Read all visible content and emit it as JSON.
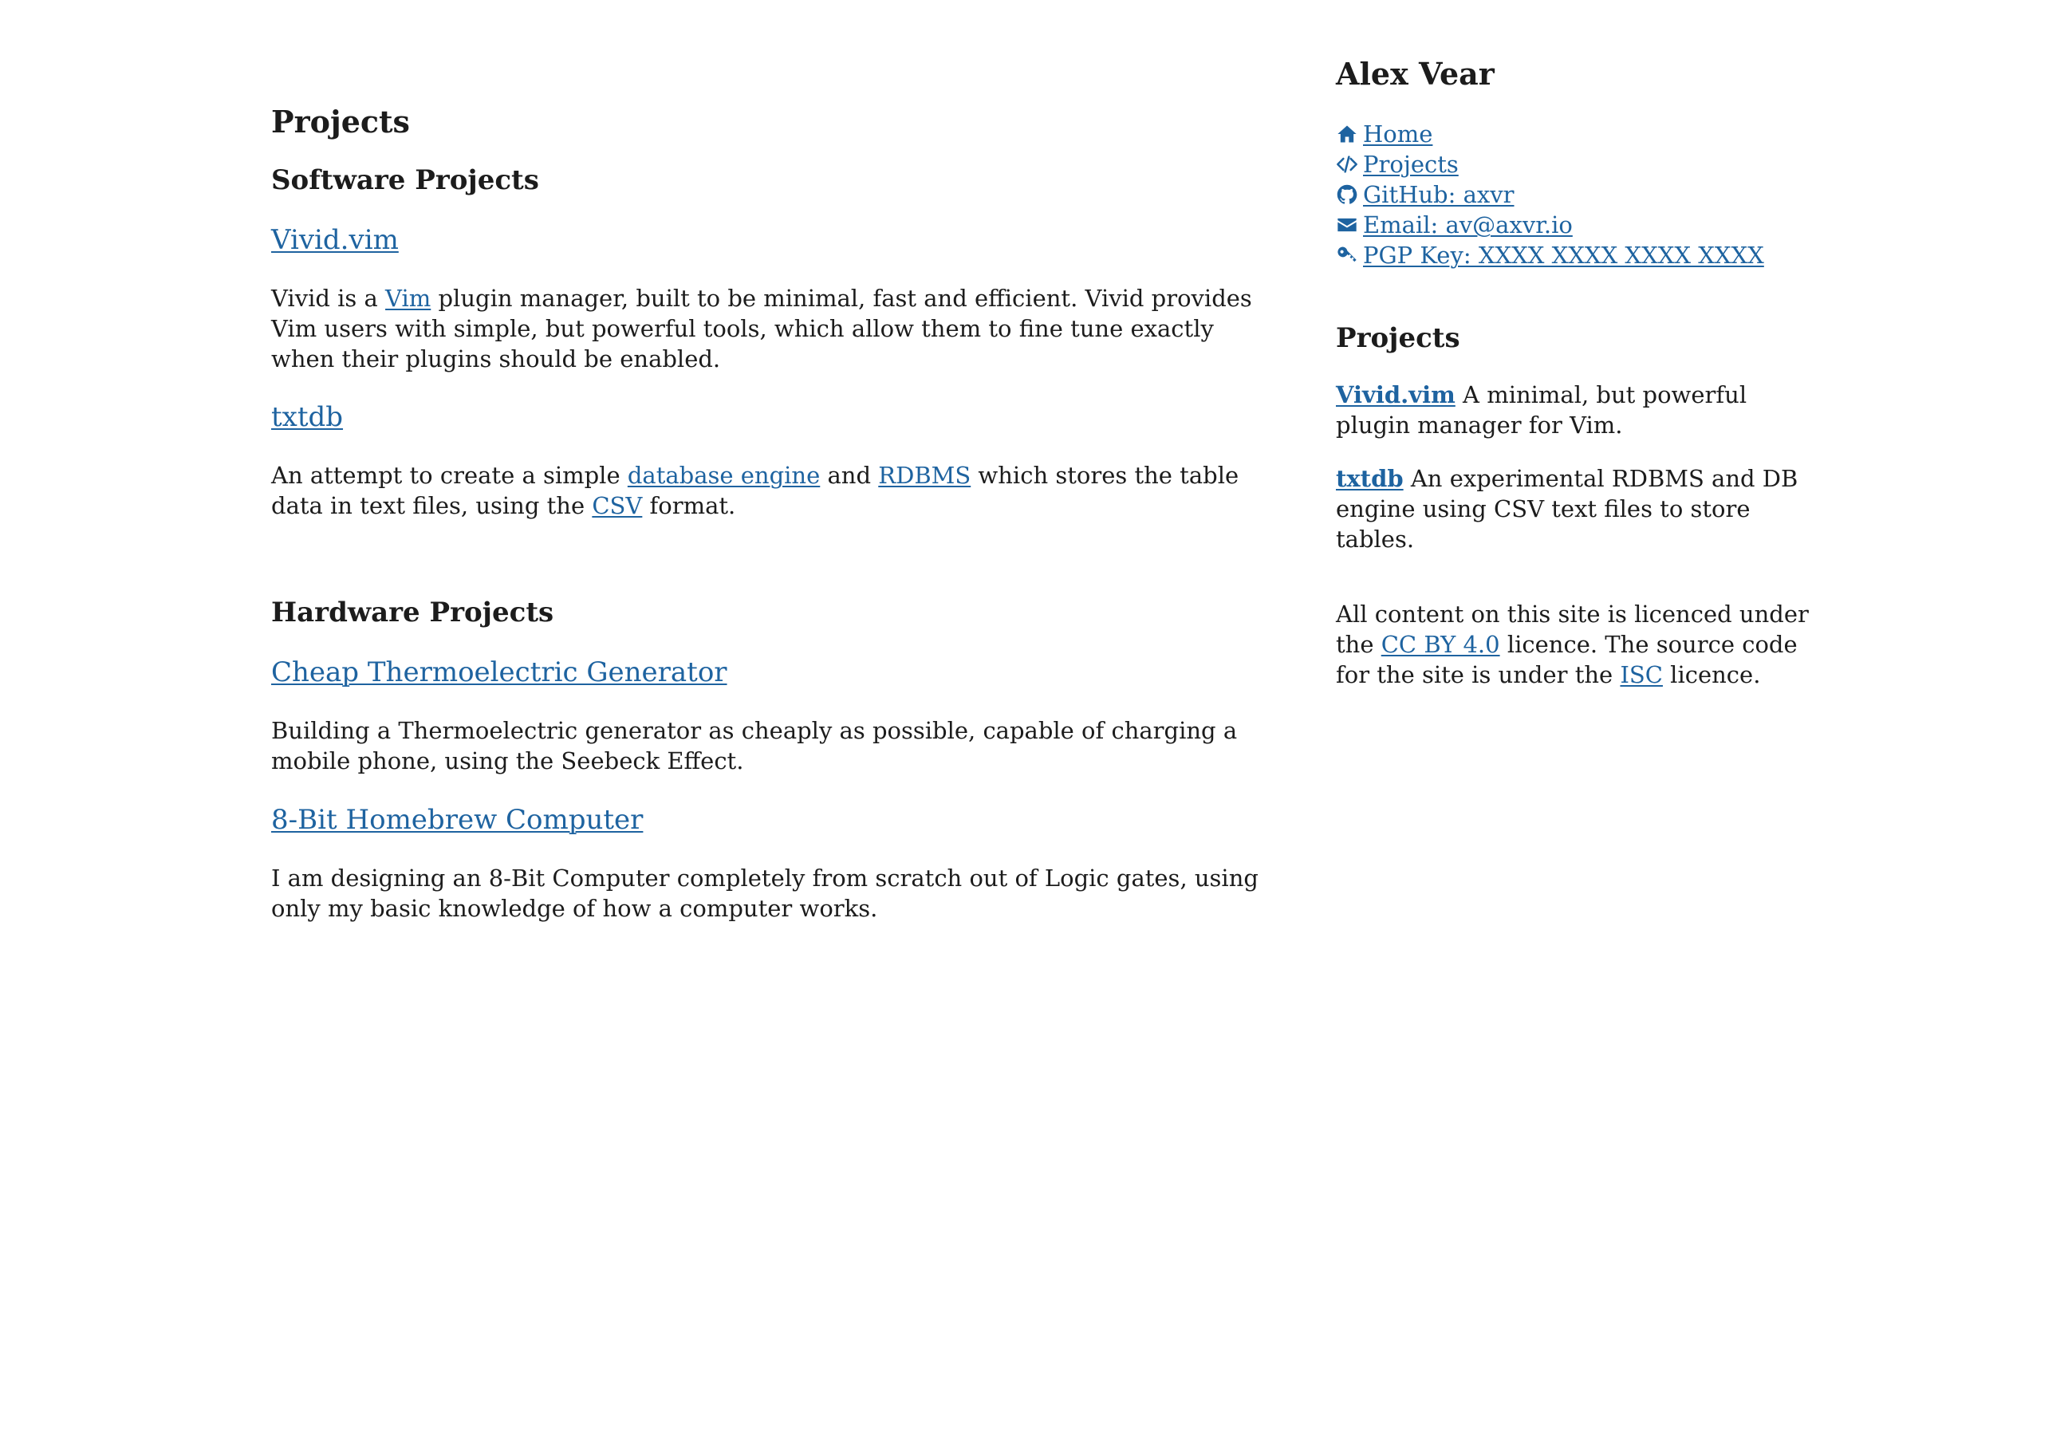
{
  "main": {
    "title": "Projects",
    "software_heading": "Software Projects",
    "hardware_heading": "Hardware Projects",
    "projects": {
      "vivid": {
        "title": "Vivid.vim",
        "desc_pre": "Vivid is a ",
        "desc_link": "Vim",
        "desc_post": " plugin manager, built to be minimal, fast and efficient. Vivid provides Vim users with simple, but powerful tools, which allow them to fine tune exactly when their plugins should be enabled."
      },
      "txtdb": {
        "title": "txtdb",
        "desc_pre": "An attempt to create a simple ",
        "desc_link1": "database engine",
        "desc_mid": " and ",
        "desc_link2": "RDBMS",
        "desc_mid2": " which stores the table data in text files, using the ",
        "desc_link3": "CSV",
        "desc_post": " format."
      },
      "teg": {
        "title": "Cheap Thermoelectric Generator",
        "desc": "Building a Thermoelectric generator as cheaply as possible, capable of charging a mobile phone, using the Seebeck Effect."
      },
      "computer": {
        "title": "8-Bit Homebrew Computer",
        "desc": "I am designing an 8-Bit Computer completely from scratch out of Logic gates, using only my basic knowledge of how a computer works."
      }
    }
  },
  "sidebar": {
    "name": "Alex Vear",
    "links": [
      {
        "icon": "home-icon",
        "label": " Home"
      },
      {
        "icon": "code-icon",
        "label": " Projects"
      },
      {
        "icon": "github-icon",
        "label": " GitHub: axvr"
      },
      {
        "icon": "envelope-icon",
        "label": " Email: av@axvr.io"
      },
      {
        "icon": "key-icon",
        "label": " PGP Key: XXXX XXXX XXXX XXXX"
      }
    ],
    "projects_heading": "Projects",
    "project_items": [
      {
        "name": "Vivid.vim",
        "desc": " A minimal, but powerful plugin manager for Vim."
      },
      {
        "name": "txtdb",
        "desc": " An experimental RDBMS and DB engine using CSV text files to store tables."
      }
    ],
    "licence": {
      "pre": "All content on this site is licenced under the ",
      "link1": "CC BY 4.0",
      "mid": " licence. The source code for the site is under the ",
      "link2": "ISC",
      "post": " licence."
    }
  },
  "colors": {
    "link": "#1e63a0",
    "text": "#1c1c1c",
    "background": "#ffffff"
  }
}
